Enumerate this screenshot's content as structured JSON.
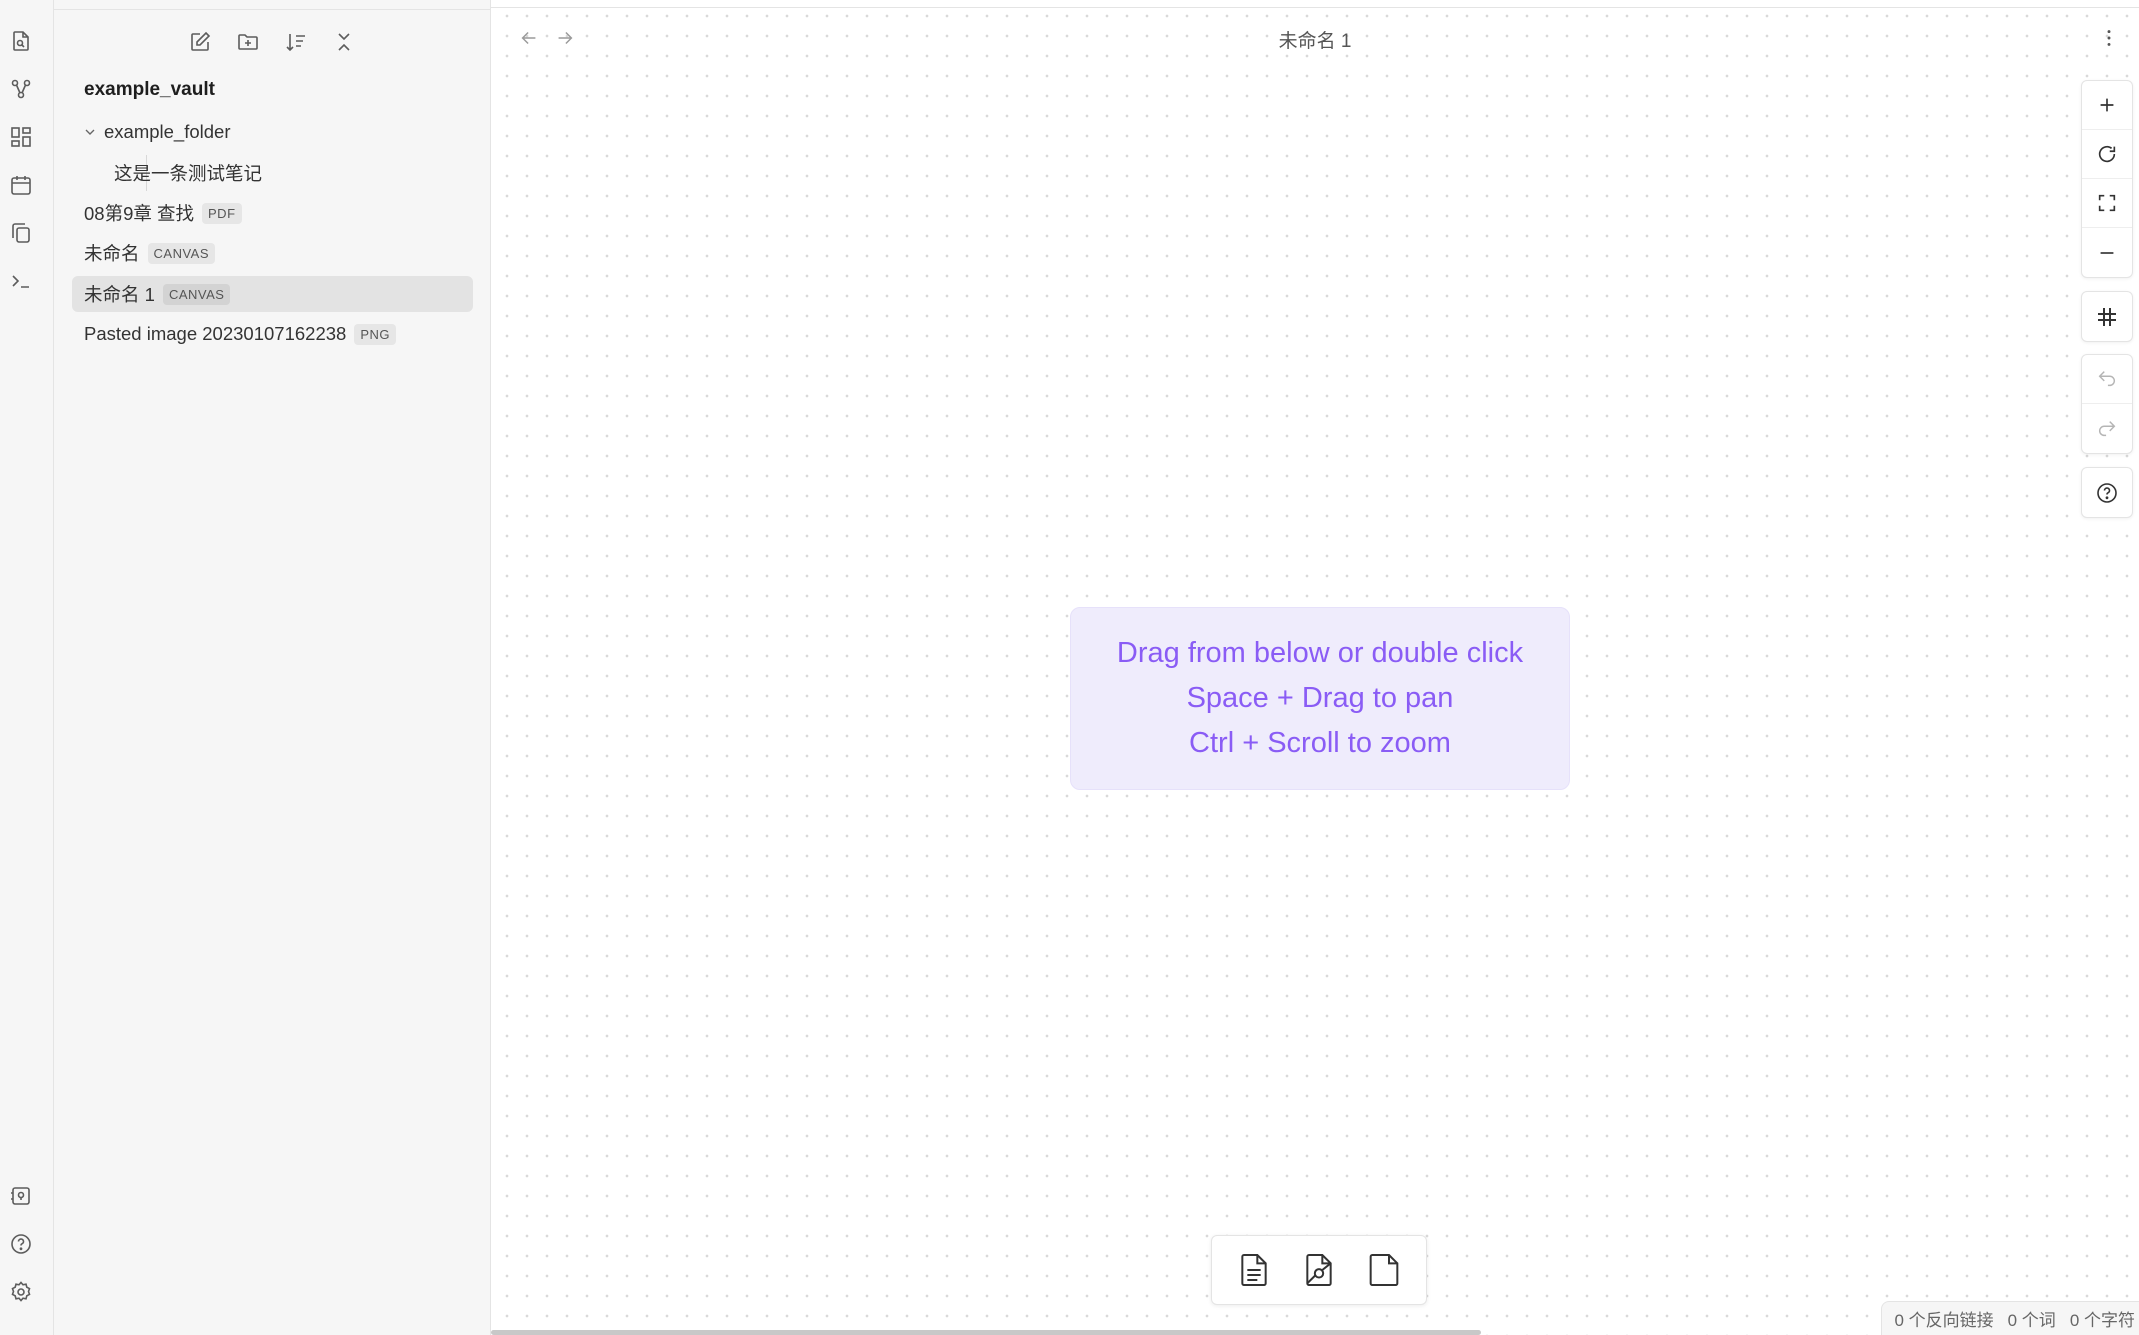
{
  "ribbon": {
    "top": [
      {
        "name": "file-search-icon"
      },
      {
        "name": "graph-view-icon"
      },
      {
        "name": "dashboard-icon"
      },
      {
        "name": "calendar-icon"
      },
      {
        "name": "copy-icon"
      },
      {
        "name": "terminal-icon"
      }
    ],
    "bottom": [
      {
        "name": "vault-switcher-icon"
      },
      {
        "name": "help-icon"
      },
      {
        "name": "settings-icon"
      }
    ]
  },
  "sidebar": {
    "actions": [
      "new-note-icon",
      "new-folder-icon",
      "sort-icon",
      "collapse-all-icon"
    ],
    "vault_name": "example_vault",
    "tree": {
      "folder": "example_folder",
      "child_note": "这是一条测试笔记",
      "files": [
        {
          "label": "08第9章 查找",
          "badge": "PDF"
        },
        {
          "label": "未命名",
          "badge": "CANVAS"
        },
        {
          "label": "未命名 1",
          "badge": "CANVAS",
          "active": true
        },
        {
          "label": "Pasted image 20230107162238",
          "badge": "PNG"
        }
      ]
    }
  },
  "main": {
    "title": "未命名 1",
    "hint": {
      "line1": "Drag from below or double click",
      "line2": "Space + Drag to pan",
      "line3": "Ctrl + Scroll to zoom"
    },
    "controls": [
      "zoom-in-icon",
      "reset-zoom-icon",
      "fit-screen-icon",
      "zoom-out-icon",
      "snap-grid-icon",
      "undo-icon",
      "redo-icon",
      "help-icon"
    ],
    "card_menu": [
      "add-note-card-icon",
      "add-media-card-icon",
      "add-text-card-icon"
    ]
  },
  "status_bar": {
    "backlinks": "0 个反向链接",
    "words": "0 个词",
    "chars": "0 个字符"
  },
  "colors": {
    "accent": "#8a5cf5",
    "hint_bg": "#efecfc",
    "sidebar_bg": "#f6f6f6",
    "active_item": "#e3e3e3"
  }
}
